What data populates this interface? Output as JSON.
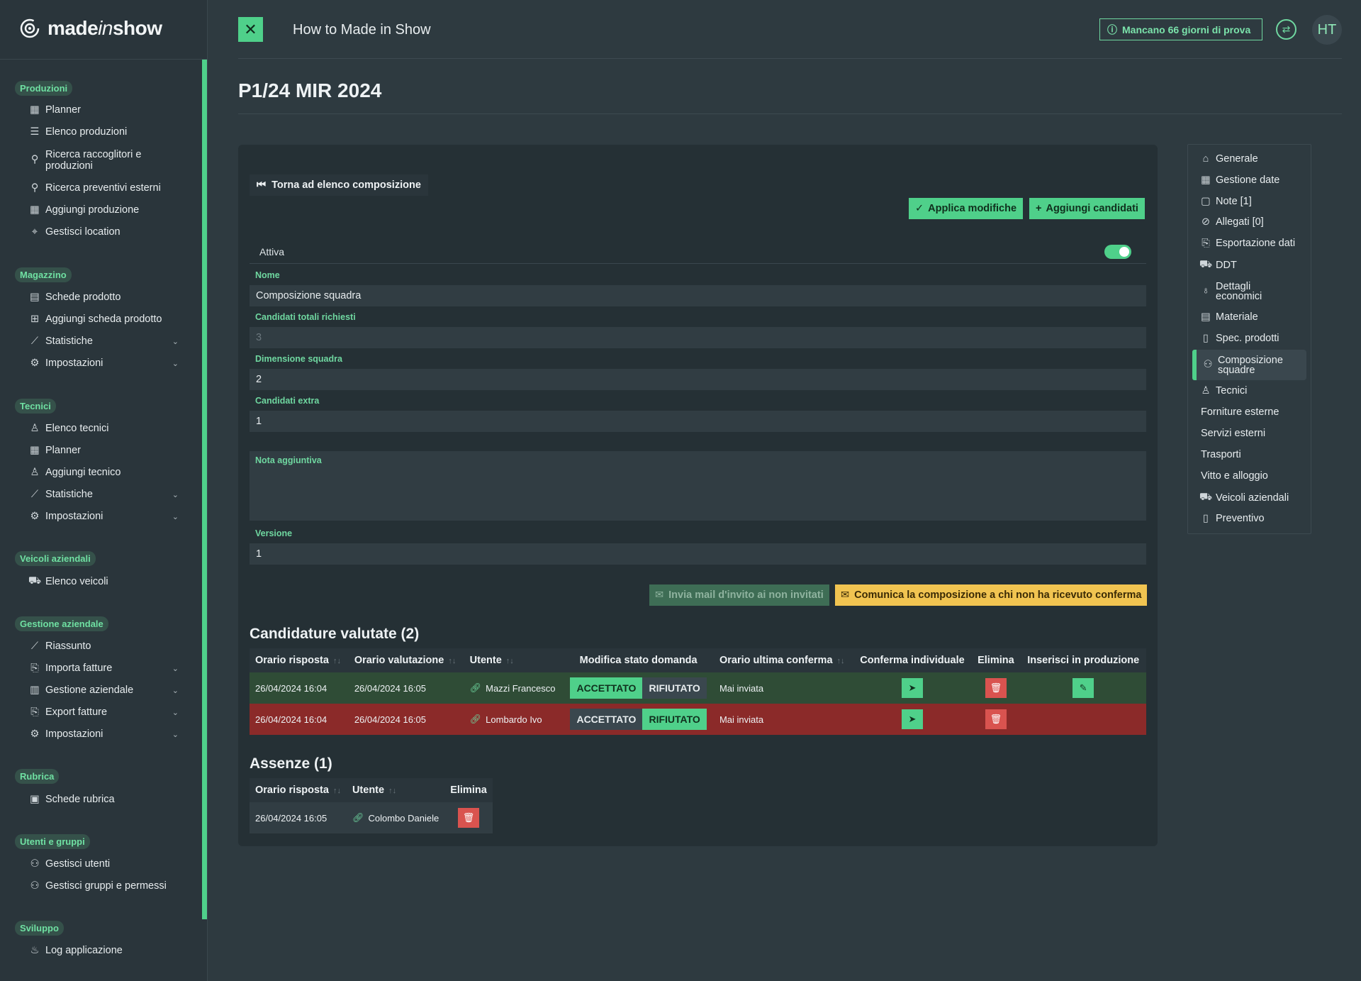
{
  "app": {
    "logo": {
      "pre": "made",
      "mid": "in",
      "post": "show"
    },
    "top_title": "How to Made in Show",
    "trial": "Mancano 66 giorni di prova",
    "avatar": "HT",
    "page_title": "P1/24 MIR 2024"
  },
  "sidebar": {
    "produzioni": {
      "label": "Produzioni",
      "items": [
        "Planner",
        "Elenco produzioni",
        "Ricerca raccoglitori e produzioni",
        "Ricerca preventivi esterni",
        "Aggiungi produzione",
        "Gestisci location"
      ]
    },
    "magazzino": {
      "label": "Magazzino",
      "items": [
        "Schede prodotto",
        "Aggiungi scheda prodotto",
        "Statistiche",
        "Impostazioni"
      ]
    },
    "tecnici": {
      "label": "Tecnici",
      "items": [
        "Elenco tecnici",
        "Planner",
        "Aggiungi tecnico",
        "Statistiche",
        "Impostazioni"
      ]
    },
    "veicoli": {
      "label": "Veicoli aziendali",
      "items": [
        "Elenco veicoli"
      ]
    },
    "gestione": {
      "label": "Gestione aziendale",
      "items": [
        "Riassunto",
        "Importa fatture",
        "Gestione aziendale",
        "Export fatture",
        "Impostazioni"
      ]
    },
    "rubrica": {
      "label": "Rubrica",
      "items": [
        "Schede rubrica"
      ]
    },
    "utenti": {
      "label": "Utenti e gruppi",
      "items": [
        "Gestisci utenti",
        "Gestisci gruppi e permessi"
      ]
    },
    "sviluppo": {
      "label": "Sviluppo",
      "items": [
        "Log applicazione"
      ]
    }
  },
  "form": {
    "back": "Torna ad elenco composizione",
    "apply": "Applica modifiche",
    "add_candidates": "Aggiungi candidati",
    "attiva": "Attiva",
    "nome_label": "Nome",
    "nome_value": "Composizione squadra",
    "cand_tot_label": "Candidati totali richiesti",
    "cand_tot_value": "3",
    "dim_label": "Dimensione squadra",
    "dim_value": "2",
    "extra_label": "Candidati extra",
    "extra_value": "1",
    "nota_label": "Nota aggiuntiva",
    "versione_label": "Versione",
    "versione_value": "1",
    "invite_btn": "Invia mail d'invito ai non invitati",
    "communicate_btn": "Comunica la composizione a chi non ha ricevuto conferma"
  },
  "candidature": {
    "title": "Candidature valutate (2)",
    "headers": [
      "Orario risposta",
      "Orario valutazione",
      "Utente",
      "Modifica stato domanda",
      "Orario ultima conferma",
      "Conferma individuale",
      "Elimina",
      "Inserisci in produzione"
    ],
    "accept": "ACCETTATO",
    "reject": "RIFIUTATO",
    "rows": [
      {
        "risposta": "26/04/2024 16:04",
        "valutazione": "26/04/2024 16:05",
        "utente": "Mazzi Francesco",
        "conferma": "Mai inviata",
        "stato": "accettato"
      },
      {
        "risposta": "26/04/2024 16:04",
        "valutazione": "26/04/2024 16:05",
        "utente": "Lombardo Ivo",
        "conferma": "Mai inviata",
        "stato": "rifiutato"
      }
    ]
  },
  "assenze": {
    "title": "Assenze (1)",
    "headers": [
      "Orario risposta",
      "Utente",
      "Elimina"
    ],
    "rows": [
      {
        "risposta": "26/04/2024 16:05",
        "utente": "Colombo Daniele"
      }
    ]
  },
  "right_nav": [
    "Generale",
    "Gestione date",
    "Note [1]",
    "Allegati [0]",
    "Esportazione dati",
    "DDT",
    "Dettagli economici",
    "Materiale",
    "Spec. prodotti",
    "Composizione squadre",
    "Tecnici",
    "Forniture esterne",
    "Servizi esterni",
    "Trasporti",
    "Vitto e alloggio",
    "Veicoli aziendali",
    "Preventivo"
  ],
  "colors": {
    "accent": "#4fd08a",
    "warning": "#f1c451",
    "danger": "#d9534f",
    "bg": "#2e3a40"
  }
}
